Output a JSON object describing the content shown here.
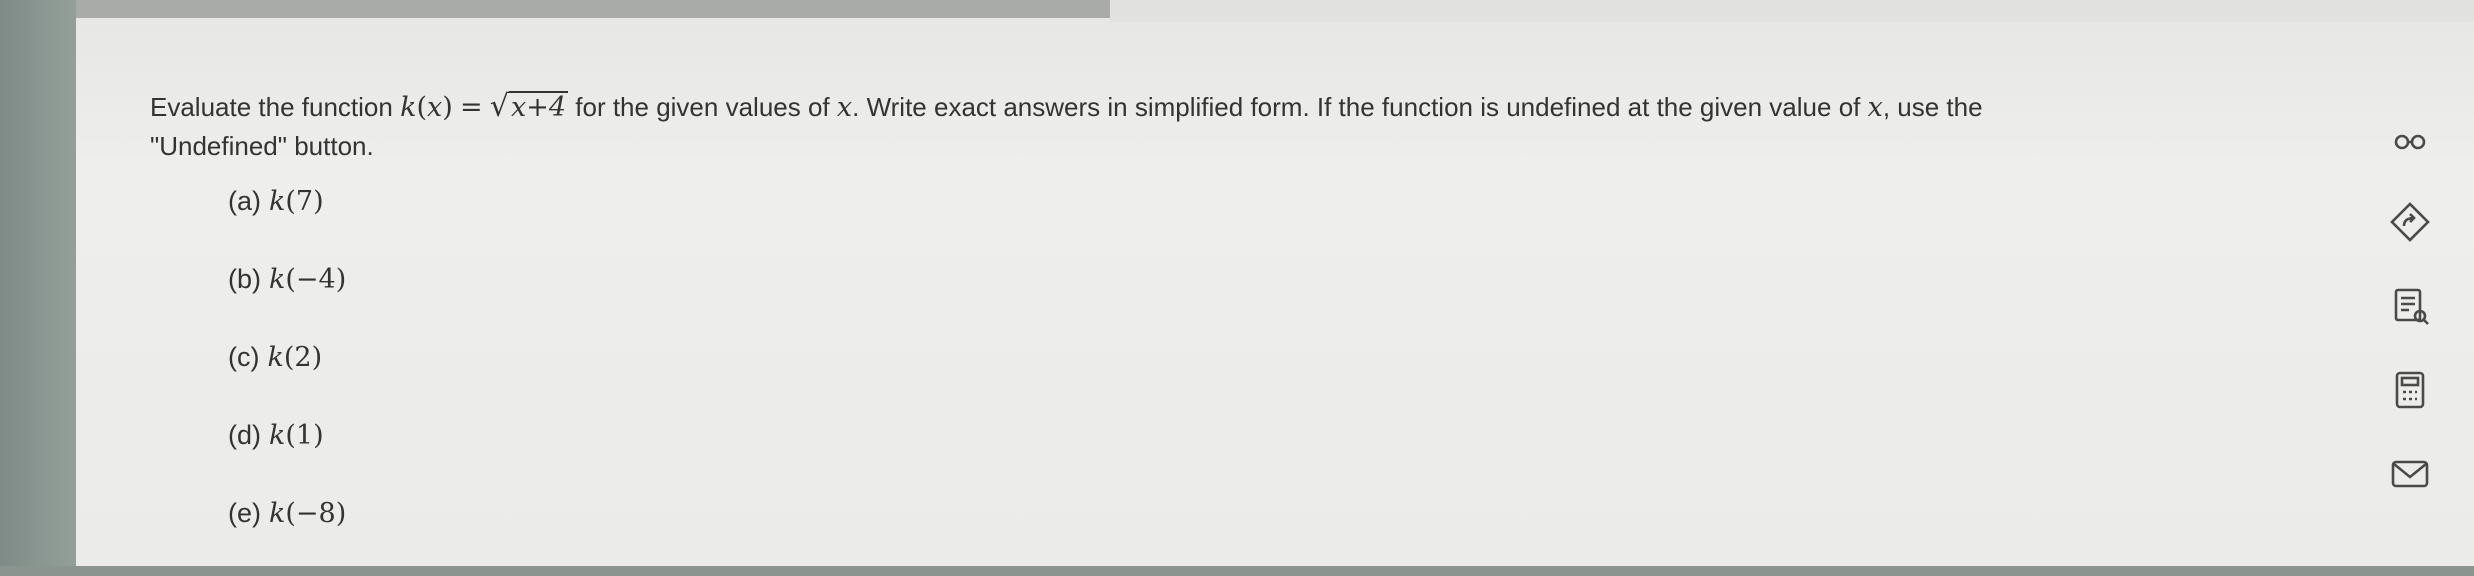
{
  "question": {
    "prefix": "Evaluate the function",
    "func_name": "k",
    "func_var": "x",
    "equals": "=",
    "radicand": "x+4",
    "middle": "for the given values of",
    "var": "x",
    "after_var": ". Write exact answers in simplified form. If the function is undefined at the given value of",
    "var2": "x",
    "suffix": ", use the",
    "line2": "\"Undefined\" button."
  },
  "parts": [
    {
      "label": "(a)",
      "expr": "(7)"
    },
    {
      "label": "(b)",
      "expr": "(−4)"
    },
    {
      "label": "(c)",
      "expr": "(2)"
    },
    {
      "label": "(d)",
      "expr": "(1)"
    },
    {
      "label": "(e)",
      "expr": "(−8)"
    }
  ],
  "toolbar": {
    "icons": [
      "glasses-icon",
      "hint-icon",
      "notes-icon",
      "calculator-icon",
      "message-icon"
    ]
  },
  "colors": {
    "text": "#333333",
    "icon": "#4a4a4a"
  }
}
